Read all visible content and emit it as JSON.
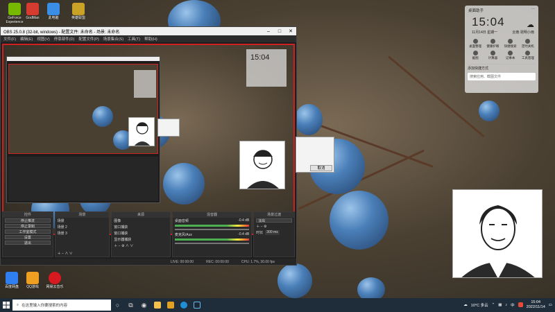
{
  "desktop": {
    "icons": [
      {
        "label": "GeForce Experience",
        "color": "#76b900"
      },
      {
        "label": "GodMan",
        "color": "#d63b2f"
      },
      {
        "label": "此电脑",
        "color": "#3a8ee6"
      },
      {
        "label": "英雄联盟",
        "color": "#c9a227"
      },
      {
        "label": "百度网盘",
        "color": "#2f7ff0"
      },
      {
        "label": "QQ游戏",
        "color": "#f0a020"
      },
      {
        "label": "网易云音乐",
        "color": "#d71920"
      }
    ]
  },
  "obs": {
    "title": "OBS 25.0.8 (32-bit, windows) - 配置文件: 未命名 - 场景: 未命名",
    "menu": [
      "文件(F)",
      "编辑(E)",
      "视图(V)",
      "停靠部件(D)",
      "配置文件(P)",
      "场景集合(S)",
      "工具(T)",
      "帮助(H)"
    ],
    "docks": {
      "controls": {
        "header": "控件",
        "buttons": [
          "停止推流",
          "停止录制",
          "工作室模式",
          "设置",
          "退出"
        ]
      },
      "scenes": {
        "header": "场景",
        "items": [
          "场景",
          "场景 2",
          "场景 3"
        ]
      },
      "sources": {
        "header": "来源",
        "items": [
          "图像",
          "窗口捕获",
          "窗口捕获",
          "显示器捕获"
        ]
      },
      "mixer": {
        "header": "混音器",
        "channels": [
          {
            "name": "桌面音频",
            "db": "-0.4 dB"
          },
          {
            "name": "麦克风/Aux",
            "db": "-0.4 dB"
          }
        ]
      },
      "transitions": {
        "header": "场景过渡",
        "type": "淡出",
        "duration_label": "时长",
        "duration": "300 ms"
      }
    },
    "status": {
      "live": "LIVE: 00:00:00",
      "rec": "REC: 00:00:00",
      "cpu": "CPU: 1.7%, 30.00 fps"
    }
  },
  "preview_clock": "15:04",
  "dialog": {
    "button": "取消"
  },
  "widget": {
    "title": "桌面助手",
    "time": "15:04",
    "date": "11月14日  星期一",
    "weather": "云南·昆明小雨",
    "items": [
      "桌面整理",
      "健康护眼",
      "快捷搜索",
      "定时关机",
      "截图",
      "计算器",
      "记事本",
      "工具管理"
    ],
    "add_label": "添加快捷方式",
    "search_placeholder": "搜索应用、截图文件"
  },
  "taskbar": {
    "search_placeholder": "在这里输入你要搜索的内容",
    "weather": "10°C 多云",
    "ime": "中",
    "time": "15:04",
    "date": "2022/11/14"
  }
}
